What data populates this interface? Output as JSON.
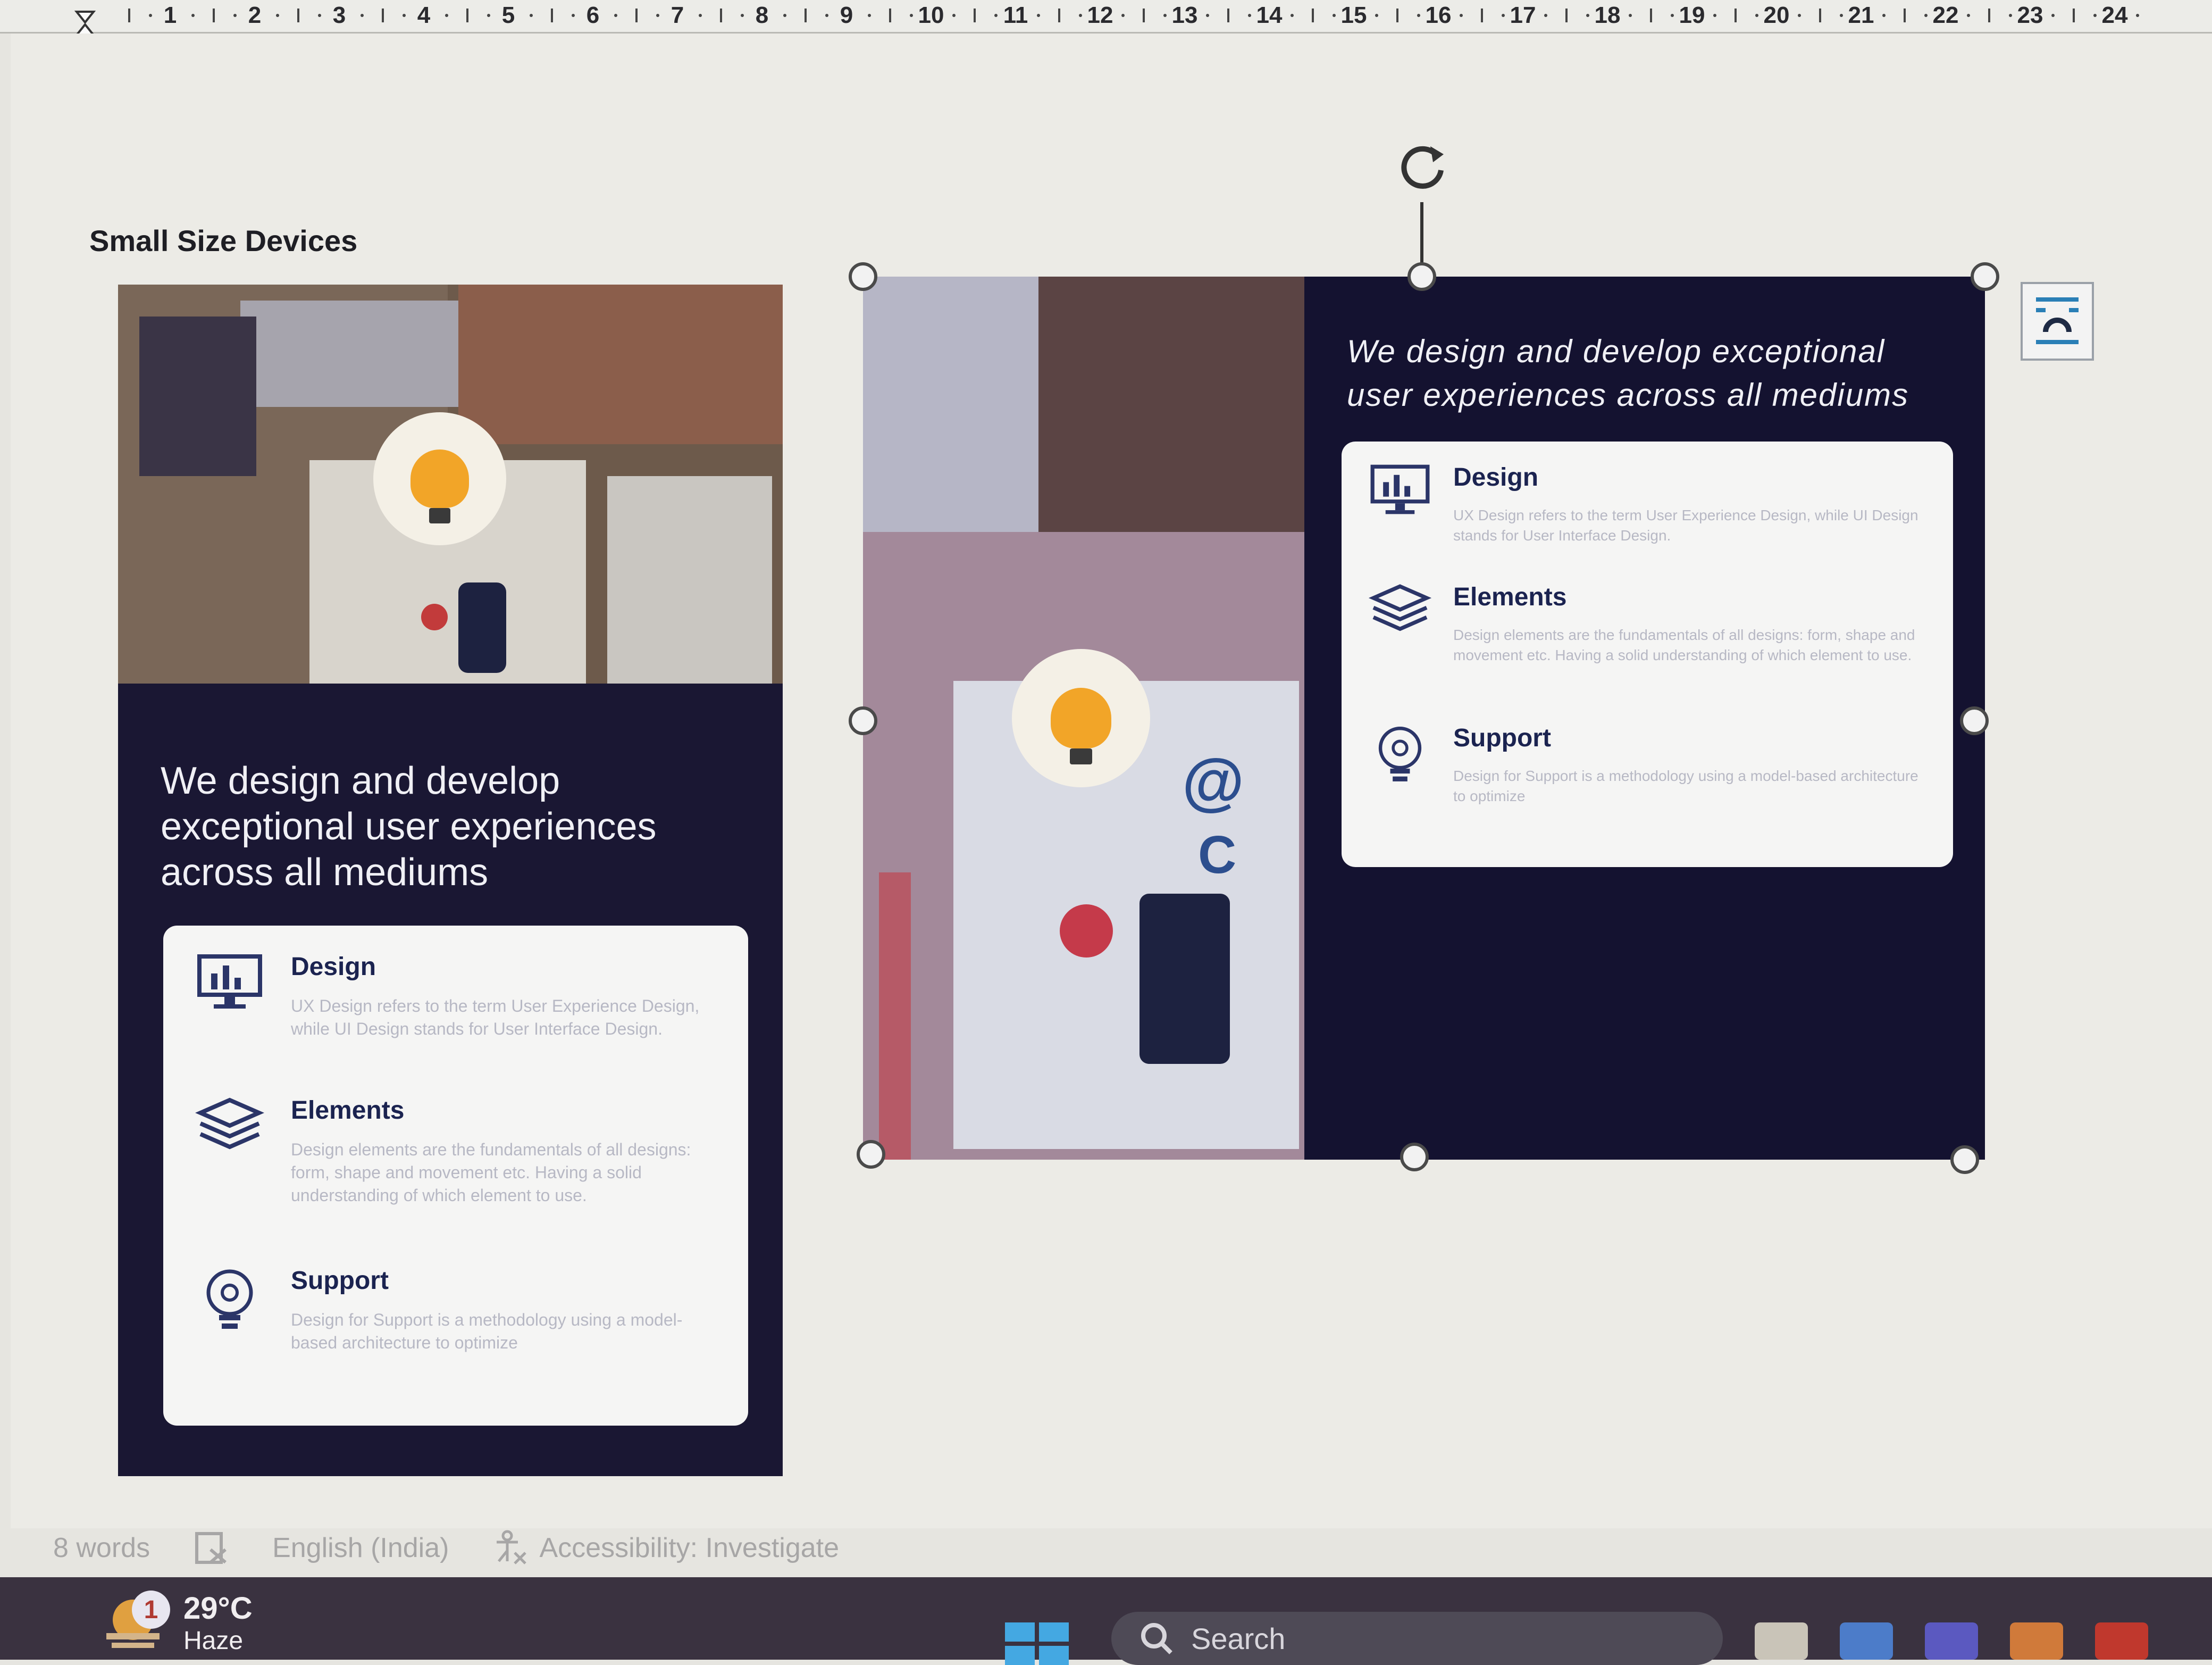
{
  "ruler": {
    "marks": [
      "1",
      "2",
      "3",
      "4",
      "5",
      "6",
      "7",
      "8",
      "9",
      "10",
      "11",
      "12",
      "13",
      "14",
      "15",
      "16",
      "17",
      "18",
      "19",
      "20",
      "21",
      "22",
      "23",
      "24"
    ]
  },
  "document": {
    "caption": "Small Size Devices",
    "card": {
      "heading": "We design and develop exceptional user experiences across all mediums",
      "features": [
        {
          "icon": "monitor-chart-icon",
          "title": "Design",
          "desc": "UX Design refers to the term User Experience Design, while UI Design stands for User Interface Design."
        },
        {
          "icon": "layers-icon",
          "title": "Elements",
          "desc": "Design elements are the fundamentals of all designs: form, shape and movement etc. Having a solid understanding of which element to use."
        },
        {
          "icon": "lightbulb-gear-icon",
          "title": "Support",
          "desc": "Design for Support is a methodology using a model-based architecture to optimize"
        }
      ]
    }
  },
  "statusbar": {
    "words": "8 words",
    "language": "English (India)",
    "accessibility": "Accessibility: Investigate"
  },
  "taskbar": {
    "weather_temp": "29°C",
    "weather_cond": "Haze",
    "notification_count": "1",
    "search_label": "Search"
  },
  "colors": {
    "card_dark": "#141230",
    "panel_light": "#f5f5f4",
    "bulb": "#f2a528",
    "taskbar": "#3a3240"
  }
}
